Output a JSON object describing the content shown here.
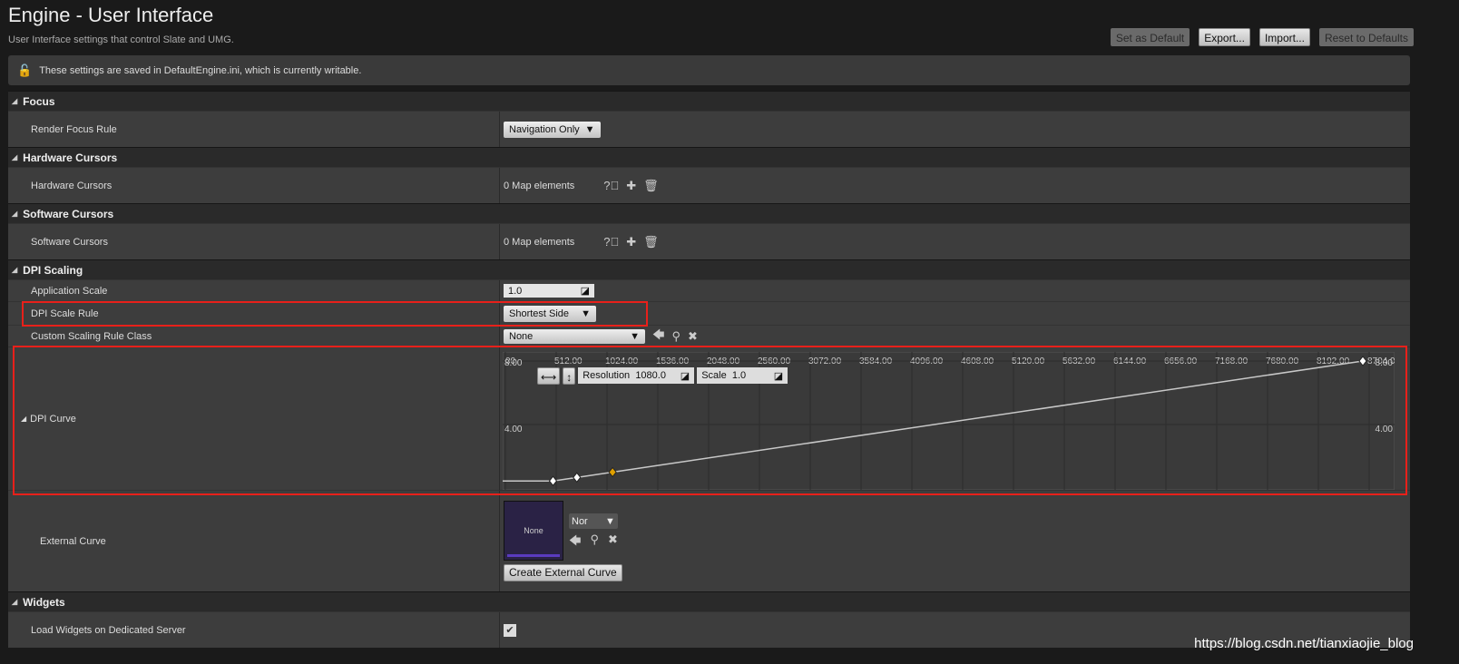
{
  "header": {
    "title": "Engine - User Interface",
    "subtitle": "User Interface settings that control Slate and UMG.",
    "buttons": [
      "Set as Default",
      "Export...",
      "Import...",
      "Reset to Defaults"
    ]
  },
  "notice": "These settings are saved in DefaultEngine.ini, which is currently writable.",
  "sections": {
    "focus": {
      "title": "Focus",
      "render_focus_rule": {
        "label": "Render Focus Rule",
        "value": "Navigation Only"
      }
    },
    "hardware": {
      "title": "Hardware Cursors",
      "label": "Hardware Cursors",
      "value": "0 Map elements"
    },
    "software": {
      "title": "Software Cursors",
      "label": "Software Cursors",
      "value": "0 Map elements"
    },
    "dpi": {
      "title": "DPI Scaling",
      "application_scale": {
        "label": "Application Scale",
        "value": "1.0"
      },
      "dpi_scale_rule": {
        "label": "DPI Scale Rule",
        "value": "Shortest Side"
      },
      "custom_rule": {
        "label": "Custom Scaling Rule Class",
        "value": "None"
      },
      "dpi_curve": {
        "label": "DPI Curve",
        "resolution_label": "Resolution",
        "resolution": "1080.0",
        "scale_label": "Scale",
        "scale": "1.0"
      },
      "external_curve": {
        "label": "External Curve",
        "thumb": "None",
        "dropdown": "Nor",
        "create_button": "Create External Curve"
      }
    },
    "widgets": {
      "title": "Widgets",
      "load_label": "Load Widgets on Dedicated Server",
      "load_checked": true
    }
  },
  "chart_data": {
    "type": "line",
    "x_ticks": [
      "00",
      "512.00",
      "1024.00",
      "1536.00",
      "2048.00",
      "2560.00",
      "3072.00",
      "3584.00",
      "4096.00",
      "4608.00",
      "5120.00",
      "5632.00",
      "6144.00",
      "6656.00",
      "7168.00",
      "7680.00",
      "8192.00",
      "8704.00"
    ],
    "y_ticks": [
      "8.00",
      "4.00"
    ],
    "points": [
      [
        480,
        0.444
      ],
      [
        720,
        0.666
      ],
      [
        1080,
        1.0
      ],
      [
        8640,
        8.0
      ]
    ],
    "selected_point": 2,
    "xlim": [
      0,
      8960
    ],
    "ylim": [
      0,
      8
    ],
    "colors": {
      "line": "#c8c8c8",
      "key": "#ffffff",
      "selected": "#e0a000"
    }
  },
  "watermark": "https://blog.csdn.net/tianxiaojie_blog"
}
